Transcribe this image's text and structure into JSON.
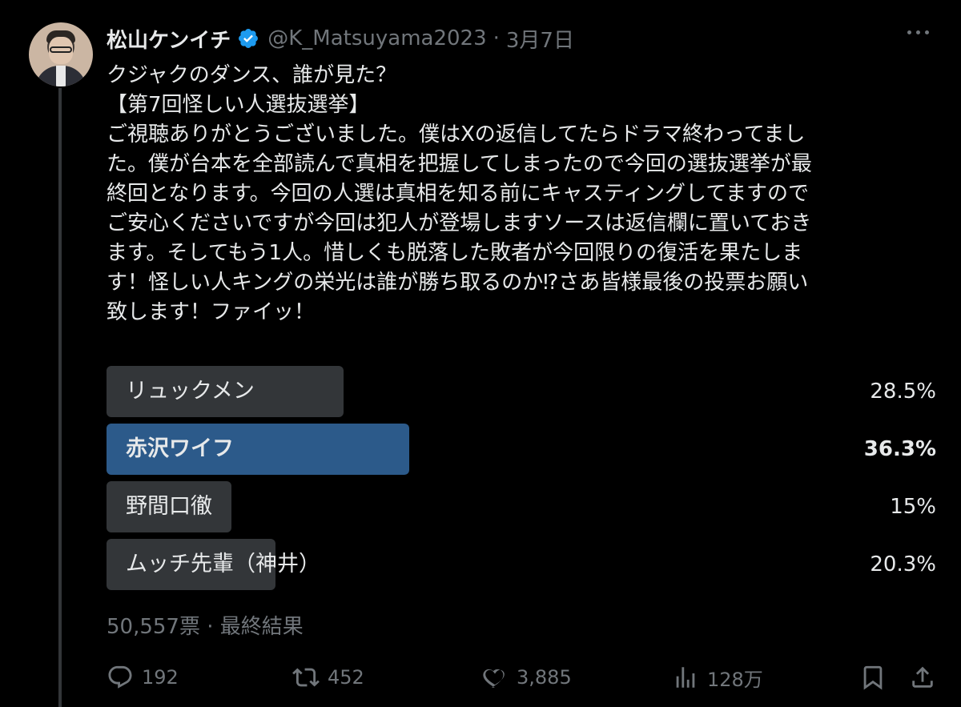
{
  "author": {
    "name": "松山ケンイチ",
    "handle": "@K_Matsuyama2023",
    "separator": "·",
    "date": "3月7日"
  },
  "body_lines": [
    "クジャクのダンス、誰が見た？",
    "【第7回怪しい人選抜選挙】",
    "ご視聴ありがとうございました。僕はXの返信してたらドラマ終わってまし",
    "た。僕が台本を全部読んで真相を把握してしまったので今回の選抜選挙が最",
    "終回となります。今回の人選は真相を知る前にキャスティングしてますので",
    "ご安心くださいですが今回は犯人が登場しますソースは返信欄に置いておき",
    "ます。そしてもう1人。惜しくも脱落した敗者が今回限りの復活を果たしま",
    "す！怪しい人キングの栄光は誰が勝ち取るのか⁉さあ皆様最後の投票お願い",
    "致します！ファイッ！"
  ],
  "poll": {
    "options": [
      {
        "label": "リュックメン",
        "percent_text": "28.5%",
        "fraction": 0.285,
        "winner": false
      },
      {
        "label": "赤沢ワイフ",
        "percent_text": "36.3%",
        "fraction": 0.363,
        "winner": true
      },
      {
        "label": "野間口徹",
        "percent_text": "15%",
        "fraction": 0.15,
        "winner": false
      },
      {
        "label": "ムッチ先輩（神井）",
        "percent_text": "20.3%",
        "fraction": 0.203,
        "winner": false
      }
    ],
    "votes": "50,557票",
    "separator": "·",
    "status": "最終結果"
  },
  "actions": {
    "reply_count": "192",
    "retweet_count": "452",
    "like_count": "3,885",
    "view_count": "128万"
  },
  "icons": {
    "verified": "verified-badge-icon",
    "more": "more-options-icon",
    "reply": "reply-icon",
    "retweet": "retweet-icon",
    "like": "heart-icon",
    "views": "views-chart-icon",
    "bookmark": "bookmark-icon",
    "share": "share-icon"
  },
  "colors": {
    "background": "#000000",
    "text": "#e7e9ea",
    "muted": "#71767b",
    "poll_bar": "#333639",
    "poll_winner_bar": "#2c5a8a",
    "verified": "#1d9bf0"
  }
}
